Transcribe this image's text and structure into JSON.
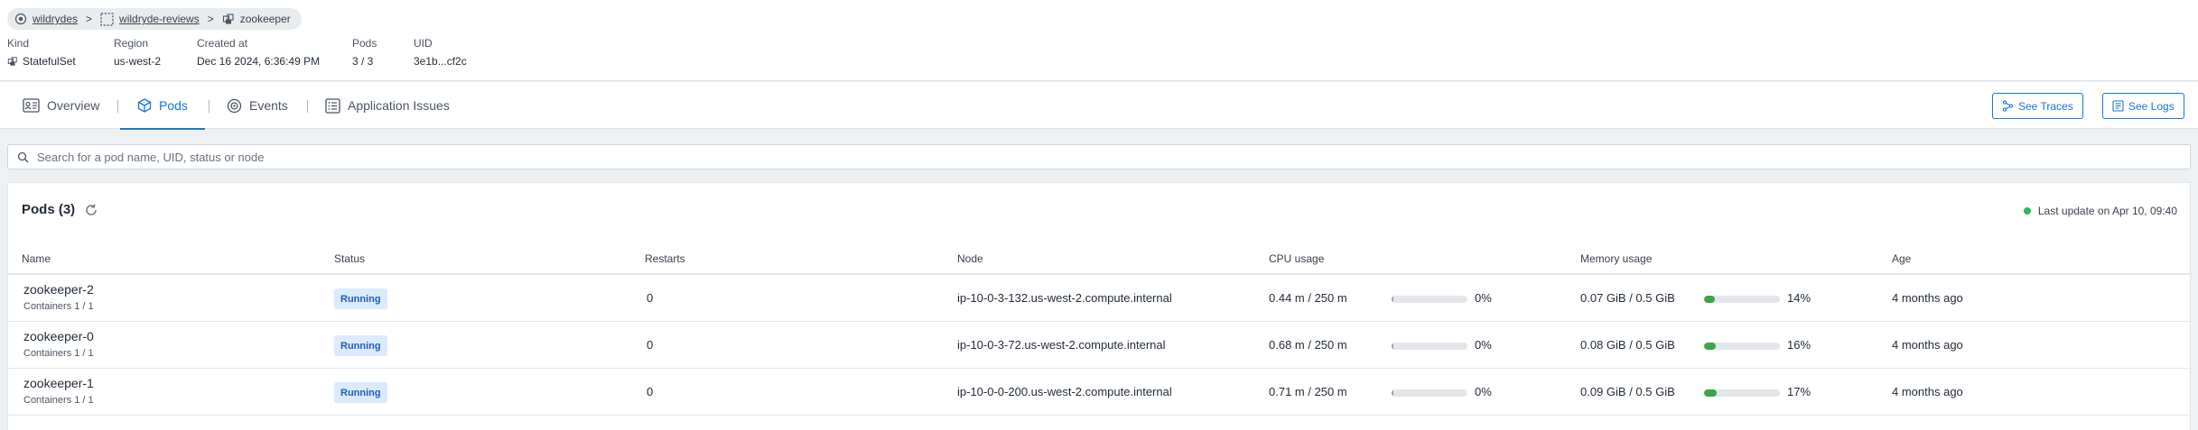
{
  "breadcrumb": [
    {
      "label": "wildrydes",
      "icon": "cluster-icon"
    },
    {
      "label": "wildryde-reviews",
      "icon": "namespace-icon"
    },
    {
      "label": "zookeeper",
      "icon": "statefulset-icon"
    }
  ],
  "breadcrumb_separator": ">",
  "meta": {
    "kind": {
      "label": "Kind",
      "value": "StatefulSet"
    },
    "region": {
      "label": "Region",
      "value": "us-west-2"
    },
    "created": {
      "label": "Created at",
      "value": "Dec 16 2024, 6:36:49 PM"
    },
    "pods": {
      "label": "Pods",
      "value": "3 / 3"
    },
    "uid": {
      "label": "UID",
      "value": "3e1b...cf2c"
    }
  },
  "tabs": [
    {
      "label": "Overview",
      "icon": "overview-icon",
      "active": false
    },
    {
      "label": "Pods",
      "icon": "cube-icon",
      "active": true
    },
    {
      "label": "Events",
      "icon": "events-icon",
      "active": false
    },
    {
      "label": "Application Issues",
      "icon": "list-icon",
      "active": false
    }
  ],
  "actions": {
    "traces_label": "See Traces",
    "logs_label": "See Logs"
  },
  "search": {
    "placeholder": "Search for a pod name, UID, status or node",
    "value": ""
  },
  "panel": {
    "title": "Pods (3)",
    "last_update": "Last update on Apr 10, 09:40"
  },
  "columns": [
    "Name",
    "Status",
    "Restarts",
    "Node",
    "CPU usage",
    "Memory usage",
    "Age"
  ],
  "rows": [
    {
      "name": "zookeeper-2",
      "containers": "Containers 1 / 1",
      "status": "Running",
      "restarts": "0",
      "node": "ip-10-0-3-132.us-west-2.compute.internal",
      "cpu": "0.44 m / 250 m",
      "cpu_pct": "0%",
      "cpu_fraction": 0.0018,
      "mem": "0.07 GiB / 0.5 GiB",
      "mem_pct": "14%",
      "mem_fraction": 0.14,
      "age": "4 months ago"
    },
    {
      "name": "zookeeper-0",
      "containers": "Containers 1 / 1",
      "status": "Running",
      "restarts": "0",
      "node": "ip-10-0-3-72.us-west-2.compute.internal",
      "cpu": "0.68 m / 250 m",
      "cpu_pct": "0%",
      "cpu_fraction": 0.0027,
      "mem": "0.08 GiB / 0.5 GiB",
      "mem_pct": "16%",
      "mem_fraction": 0.16,
      "age": "4 months ago"
    },
    {
      "name": "zookeeper-1",
      "containers": "Containers 1 / 1",
      "status": "Running",
      "restarts": "0",
      "node": "ip-10-0-0-200.us-west-2.compute.internal",
      "cpu": "0.71 m / 250 m",
      "cpu_pct": "0%",
      "cpu_fraction": 0.0028,
      "mem": "0.09 GiB / 0.5 GiB",
      "mem_pct": "17%",
      "mem_fraction": 0.17,
      "age": "4 months ago"
    }
  ],
  "colors": {
    "accent": "#1976d2",
    "status_ok": "#2eb85c",
    "badge_bg": "#dbeafe",
    "bar_fill": "#3aa845"
  }
}
